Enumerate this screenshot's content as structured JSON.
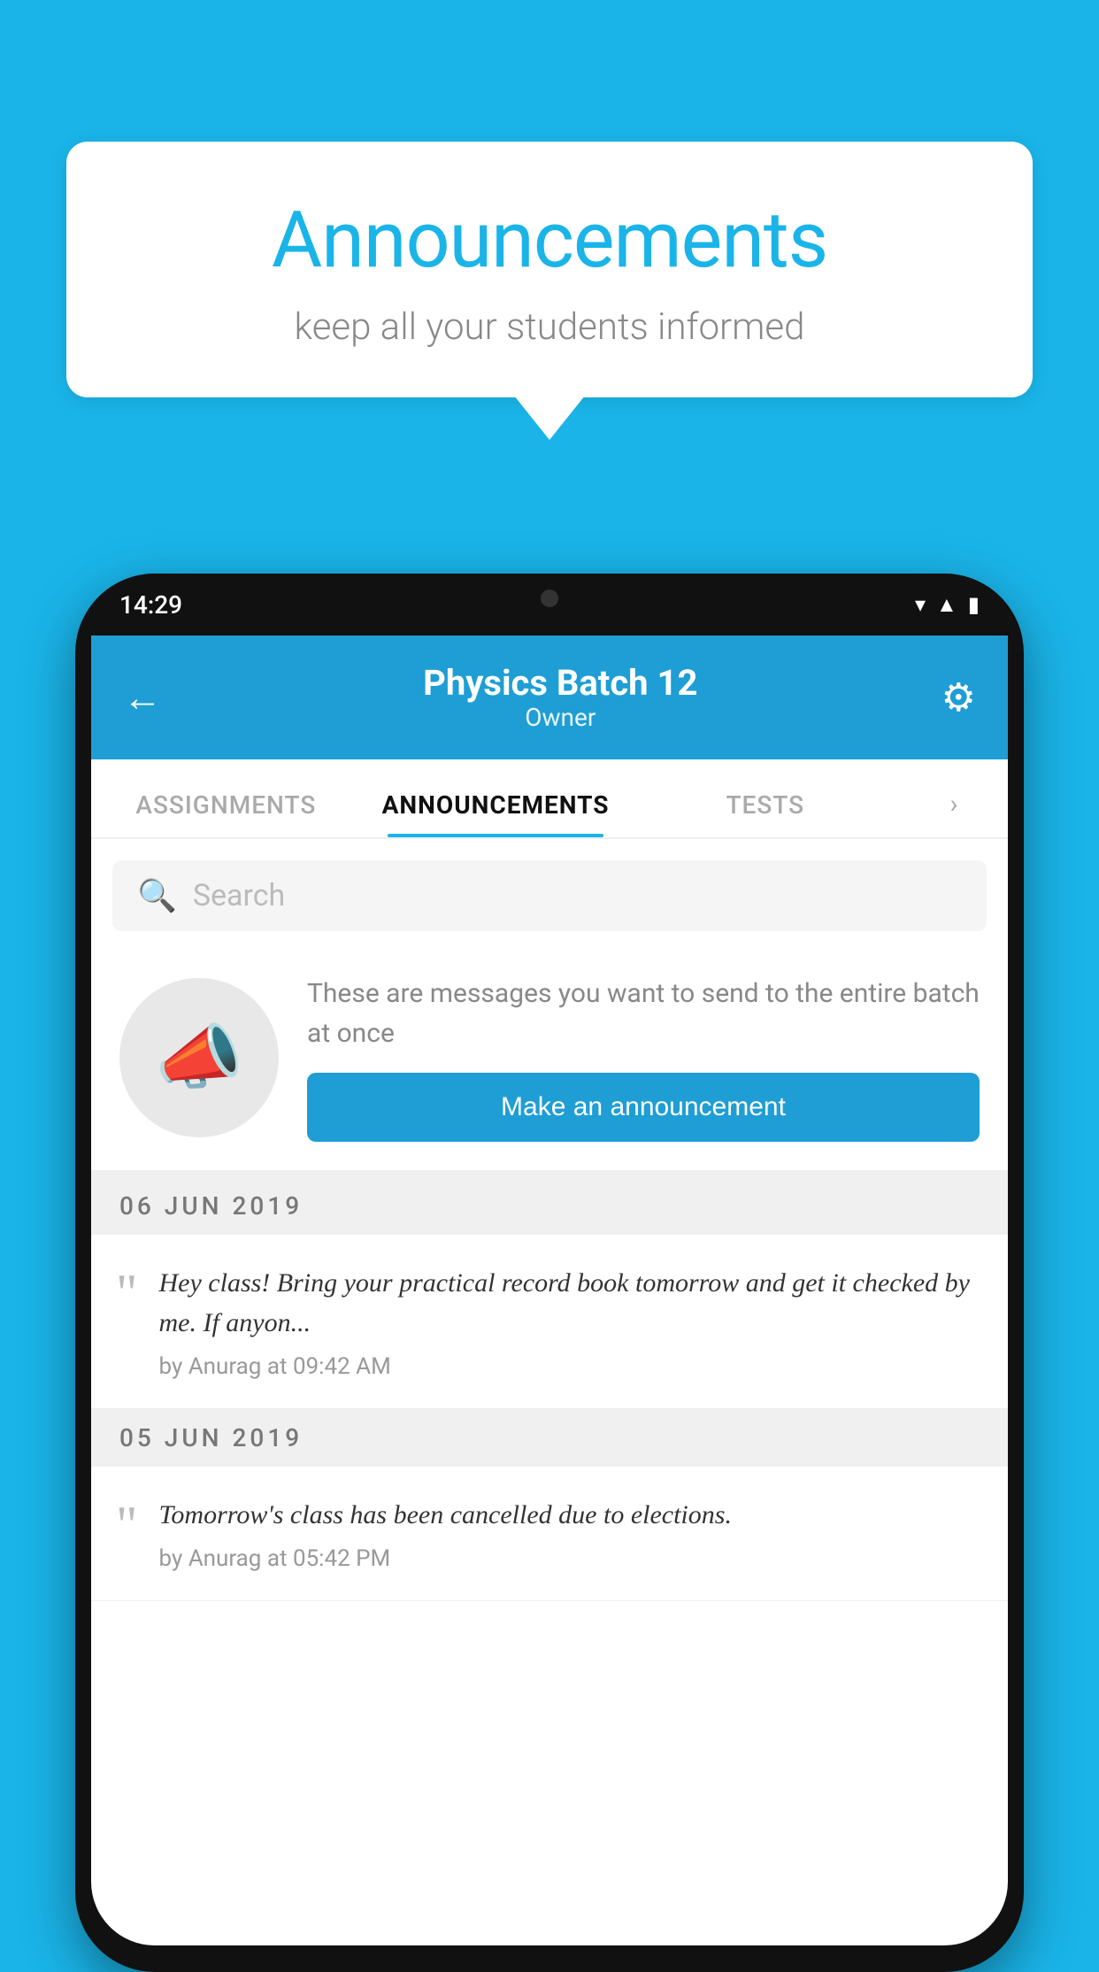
{
  "background_color": "#1ab4e8",
  "speech_bubble": {
    "title": "Announcements",
    "subtitle": "keep all your students informed"
  },
  "phone": {
    "status_bar": {
      "time": "14:29"
    },
    "app_bar": {
      "title": "Physics Batch 12",
      "subtitle": "Owner",
      "back_label": "←",
      "settings_label": "⚙"
    },
    "tabs": [
      {
        "label": "ASSIGNMENTS",
        "active": false
      },
      {
        "label": "ANNOUNCEMENTS",
        "active": true
      },
      {
        "label": "TESTS",
        "active": false
      }
    ],
    "search": {
      "placeholder": "Search"
    },
    "promo": {
      "description": "These are messages you want to send to the entire batch at once",
      "button_label": "Make an announcement"
    },
    "announcements": [
      {
        "date": "06  JUN  2019",
        "text": "Hey class! Bring your practical record book tomorrow and get it checked by me. If anyon...",
        "meta": "by Anurag at 09:42 AM"
      },
      {
        "date": "05  JUN  2019",
        "text": "Tomorrow's class has been cancelled due to elections.",
        "meta": "by Anurag at 05:42 PM"
      }
    ]
  }
}
